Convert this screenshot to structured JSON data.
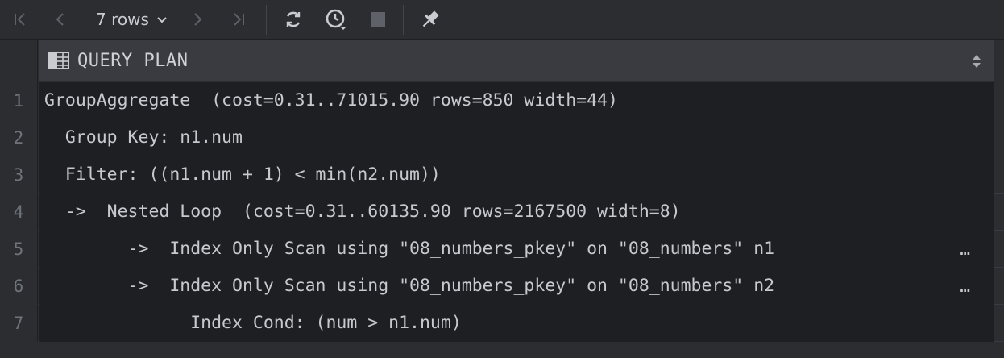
{
  "toolbar": {
    "rows_label": "7 rows",
    "icons": [
      "first-page-icon",
      "prev-page-icon",
      "chevron-down-icon",
      "next-page-icon",
      "last-page-icon",
      "refresh-icon",
      "history-icon",
      "stop-icon",
      "pin-icon"
    ]
  },
  "header": {
    "column_title": "QUERY PLAN"
  },
  "rows": [
    {
      "num": "1",
      "text": "GroupAggregate  (cost=0.31..71015.90 rows=850 width=44)"
    },
    {
      "num": "2",
      "text": "  Group Key: n1.num"
    },
    {
      "num": "3",
      "text": "  Filter: ((n1.num + 1) < min(n2.num))"
    },
    {
      "num": "4",
      "text": "  ->  Nested Loop  (cost=0.31..60135.90 rows=2167500 width=8)"
    },
    {
      "num": "5",
      "text": "        ->  Index Only Scan using \"08_numbers_pkey\" on \"08_numbers\" n1",
      "truncated": "…"
    },
    {
      "num": "6",
      "text": "        ->  Index Only Scan using \"08_numbers_pkey\" on \"08_numbers\" n2",
      "truncated": "…"
    },
    {
      "num": "7",
      "text": "              Index Cond: (num > n1.num)"
    }
  ]
}
